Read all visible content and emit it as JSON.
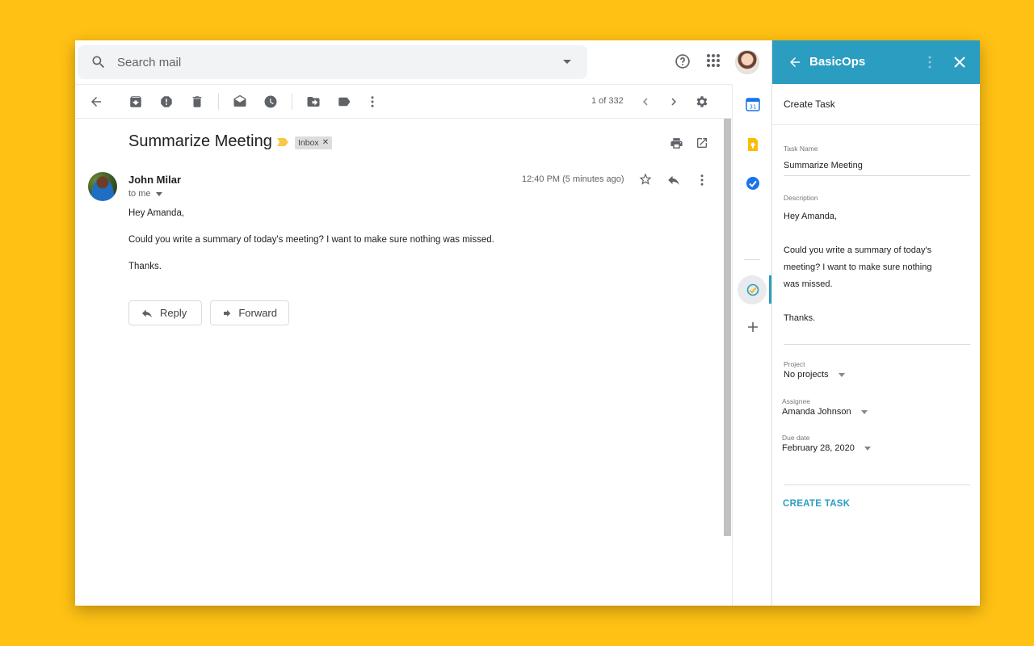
{
  "gmail": {
    "search": {
      "placeholder": "Search mail"
    },
    "pager": {
      "text": "1 of 332"
    },
    "email": {
      "subject": "Summarize Meeting",
      "label": "Inbox",
      "sender": "John Milar",
      "recipient": "to me",
      "timestamp": "12:40 PM (5 minutes ago)",
      "body": [
        "Hey Amanda,",
        "Could you write a summary of today's meeting? I want to make sure nothing was missed.",
        "Thanks."
      ]
    },
    "buttons": {
      "reply": "Reply",
      "forward": "Forward"
    }
  },
  "panel": {
    "app_name": "BasicOps",
    "heading": "Create Task",
    "task_name_label": "Task Name",
    "task_name_value": "Summarize Meeting",
    "description_label": "Description",
    "description_lines": [
      "Hey Amanda,",
      "",
      "Could you write a summary of today's",
      "meeting? I want to make sure nothing",
      "was missed.",
      "",
      "Thanks."
    ],
    "project_label": "Project",
    "project_value": "No projects",
    "assignee_label": "Assignee",
    "assignee_value": "Amanda Johnson",
    "due_label": "Due date",
    "due_value": "February 28, 2020",
    "create_label": "CREATE TASK",
    "accent_color": "#2b9dc0"
  },
  "background_color": "#FFC114"
}
